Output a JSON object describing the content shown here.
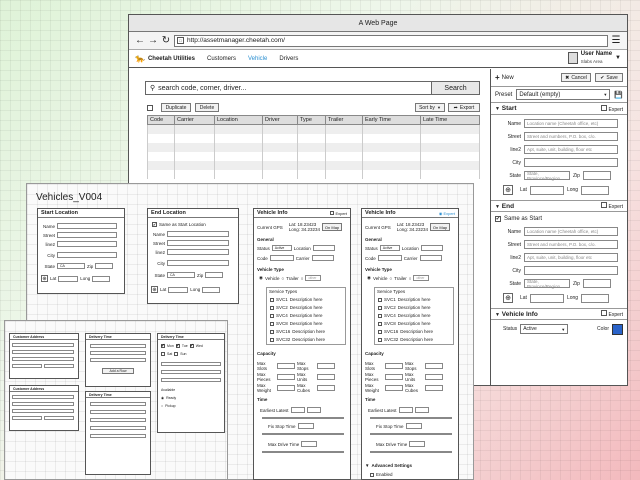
{
  "browser": {
    "title": "A Web Page",
    "url": "http://assetmanager.cheetah.com/"
  },
  "app": {
    "logo": "Cheetah Utilities",
    "nav": [
      "Customers",
      "Vehicle",
      "Drivers"
    ],
    "user_name": "User Name",
    "user_area": "Slabs Area"
  },
  "search": {
    "placeholder": "search code, corner, driver...",
    "button": "Search"
  },
  "toolbar": {
    "duplicate": "Duplicate",
    "delete": "Delete",
    "sort": "Sort by",
    "export": "Export"
  },
  "table": {
    "columns": [
      "Code",
      "Carrier",
      "Location",
      "Driver",
      "Type",
      "Trailer",
      "Early Time",
      "Late Time"
    ]
  },
  "right": {
    "new": "New",
    "cancel": "Cancel",
    "save": "Save",
    "preset_label": "Preset",
    "preset_value": "Default (empty)",
    "start_title": "Start",
    "end_title": "End",
    "expert": "Expert",
    "same_as_start": "Same as Start",
    "labels": {
      "name": "Name",
      "street": "Street",
      "line2": "line2",
      "city": "City",
      "state": "State",
      "zip": "Zip",
      "lat": "Lat",
      "long": "Long"
    },
    "placeholders": {
      "name": "Location name (Cheetah office, etc)",
      "street": "Street and numbers, P.O. box, c/o.",
      "line2": "Apt, suite, unit, building, floor etc",
      "state": "State, Province/Region"
    },
    "vehicle_title": "Vehicle Info",
    "status_label": "Status",
    "status_value": "Active",
    "color_label": "Color"
  },
  "vehicles": {
    "title": "Vehicles_V004",
    "start_location": "Start Location",
    "end_location": "End Location",
    "vehicle_info": "Vehicle Info",
    "same_as_start": "Same as Start Location",
    "state_value": "CA",
    "current_gps": "Current GPS",
    "lat_value": "Lat: 18.23423",
    "long_value": "Long: 34.23234",
    "on_map": "On Map",
    "general": "General",
    "status_label": "Status",
    "status_value": "Active",
    "location_label": "Location",
    "code_label": "Code",
    "carrier_label": "Carrier",
    "vehicle_type": "Vehicle Type",
    "vehicle": "Vehicle",
    "trailer": "Trailer",
    "other": "other",
    "service_types": "Service Types",
    "services": [
      "SVC1",
      "SVC2",
      "SVC4",
      "SVC8",
      "SVC16",
      "SVC32"
    ],
    "service_desc": "Description here",
    "capacity": "Capacity",
    "cap_rows": [
      [
        "Max Slots",
        "Max Stops"
      ],
      [
        "Max Pieces",
        "Max Units"
      ],
      [
        "Max Weight",
        "Max Cubes"
      ]
    ],
    "time": "Time",
    "earliest_latest": "Earliest Latest",
    "fix_stop_time": "Fix Stop Time",
    "max_drive_time": "Max Drive Time",
    "advanced": "Advanced Settings",
    "enabled": "Enabled"
  },
  "mini": {
    "customer_address": "Customer Address",
    "delivery_time": "Delivery Time",
    "add_item": "Add a Row",
    "days": [
      "Mon",
      "Tue",
      "Wed",
      "Thu",
      "Fri",
      "Sat",
      "Sun"
    ],
    "available": "Available",
    "ready": "Ready",
    "pickup": "Pickup"
  }
}
